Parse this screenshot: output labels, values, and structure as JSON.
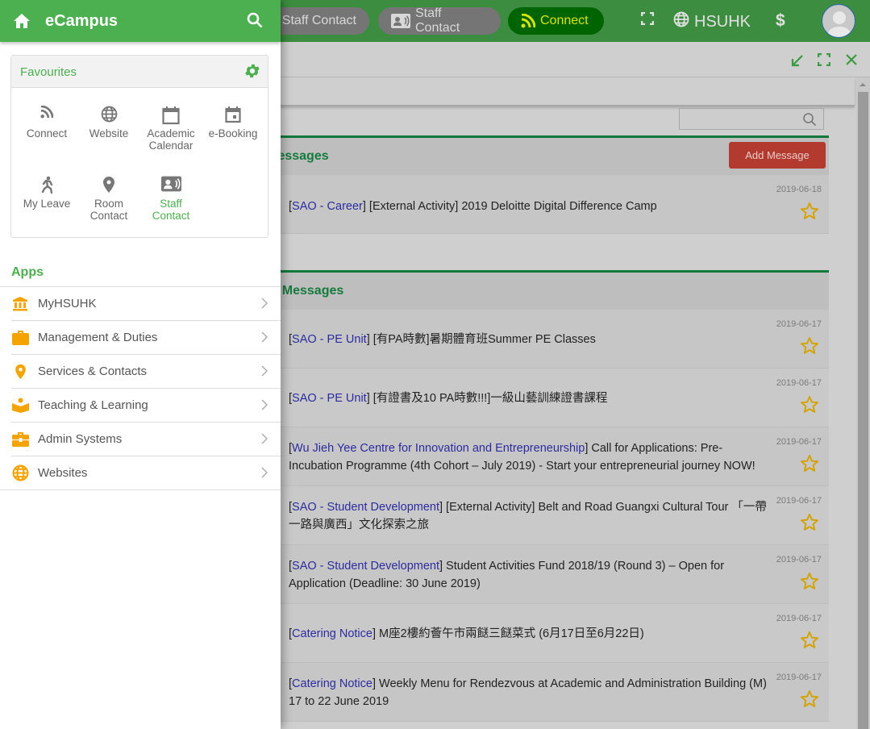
{
  "topbar": {
    "chips": [
      {
        "label": "Staff Contact",
        "icon": "staff-contact-icon"
      },
      {
        "label": "Staff Contact",
        "icon": "staff-contact-icon"
      },
      {
        "label": "Connect",
        "icon": "rss-icon",
        "active": true
      }
    ],
    "org_label": "HSUHK",
    "currency_symbol": "$"
  },
  "window": {
    "search": {
      "placeholder": "",
      "value": ""
    },
    "panels": [
      {
        "title": "Messages",
        "title_visible": "lessages",
        "add_button": "Add Message",
        "messages": [
          {
            "category": "SAO - Career",
            "text": " [External Activity] 2019 Deloitte Digital Difference Camp",
            "date": "2019-06-18"
          }
        ]
      },
      {
        "title_visible": "t Messages",
        "messages": [
          {
            "category": "SAO - PE Unit",
            "text": " [有PA時數]暑期體育班Summer PE Classes",
            "date": "2019-06-17"
          },
          {
            "category": "SAO - PE Unit",
            "text": " [有證書及10 PA時數!!!]一級山藝訓練證書課程",
            "date": "2019-06-17"
          },
          {
            "category": "Wu Jieh Yee Centre for Innovation and Entrepreneurship",
            "text": " Call for Applications: Pre-Incubation Programme (4th Cohort – July 2019) - Start your entrepreneurial journey NOW!",
            "date": "2019-06-17"
          },
          {
            "category": "SAO - Student Development",
            "text": " [External Activity] Belt and Road Guangxi Cultural Tour 「一帶一路與廣西」文化探索之旅",
            "date": "2019-06-17"
          },
          {
            "category": "SAO - Student Development",
            "text": " Student Activities Fund 2018/19 (Round 3) – Open for Application (Deadline: 30 June 2019)",
            "date": "2019-06-17"
          },
          {
            "category": "Catering Notice",
            "text": " M座2樓約薈午市兩餸三餸菜式 (6月17日至6月22日)",
            "date": "2019-06-17"
          },
          {
            "category": "Catering Notice",
            "text": " Weekly Menu for Rendezvous at Academic and Administration Building (M) 17 to 22 June 2019",
            "date": "2019-06-17"
          }
        ]
      }
    ]
  },
  "drawer": {
    "title": "eCampus",
    "favourites": {
      "title": "Favourites",
      "items": [
        {
          "label": "Connect",
          "icon": "rss-icon"
        },
        {
          "label": "Website",
          "icon": "globe-icon"
        },
        {
          "label": "Academic Calendar",
          "icon": "calendar-icon"
        },
        {
          "label": "e-Booking",
          "icon": "calendar-event-icon"
        },
        {
          "label": "My Leave",
          "icon": "running-person-icon"
        },
        {
          "label": "Room Contact",
          "icon": "map-pin-icon"
        },
        {
          "label": "Staff Contact",
          "icon": "staff-contact-icon",
          "active": true
        }
      ]
    },
    "apps": {
      "title": "Apps",
      "items": [
        {
          "label": "MyHSUHK",
          "icon": "institution-icon"
        },
        {
          "label": "Management & Duties",
          "icon": "briefcase-icon"
        },
        {
          "label": "Services & Contacts",
          "icon": "map-pin-icon"
        },
        {
          "label": "Teaching & Learning",
          "icon": "reader-icon"
        },
        {
          "label": "Admin Systems",
          "icon": "toolbox-icon"
        },
        {
          "label": "Websites",
          "icon": "globe-icon"
        }
      ]
    }
  },
  "colors": {
    "brand_green": "#4cb050",
    "header_green_dim": "#3c8d40",
    "connect_active": "#006400",
    "add_button": "#b23a2e",
    "app_icon": "#f5a300",
    "star": "#d4a300",
    "category_link": "#2c2ca0"
  }
}
